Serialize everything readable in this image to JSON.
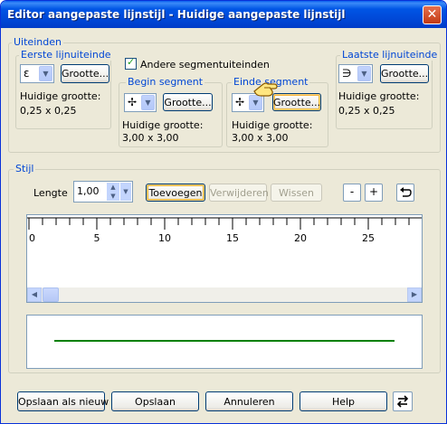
{
  "window": {
    "title": "Editor aangepaste lijnstijl - Huidige aangepaste lijnstijl",
    "close_glyph": "✕"
  },
  "ends": {
    "legend": "Uiteinden",
    "first": {
      "legend": "Eerste lijnuiteinde",
      "glyph": "ε",
      "size_button": "Grootte...",
      "current_label": "Huidige grootte:",
      "current_value": "0,25 x 0,25"
    },
    "last": {
      "legend": "Laatste lijnuiteinde",
      "glyph": "∋",
      "size_button": "Grootte...",
      "current_label": "Huidige grootte:",
      "current_value": "0,25 x 0,25"
    },
    "segment_checkbox": {
      "label": "Andere segmentuiteinden",
      "checked": true
    },
    "begin_segment": {
      "legend": "Begin segment",
      "glyph": "✢",
      "size_button": "Grootte...",
      "current_label": "Huidige grootte:",
      "current_value": "3,00 x 3,00"
    },
    "end_segment": {
      "legend": "Einde segment",
      "glyph": "✢",
      "size_button": "Grootte...",
      "current_label": "Huidige grootte:",
      "current_value": "3,00 x 3,00"
    }
  },
  "style": {
    "legend": "Stijl",
    "length_label": "Lengte",
    "length_value": "1,00",
    "add_button": "Toevoegen",
    "remove_button": "Verwijderen",
    "clear_button": "Wissen",
    "zoom_out": "-",
    "zoom_in": "+",
    "ruler_labels": [
      "0",
      "5",
      "10",
      "15",
      "20",
      "25"
    ],
    "preview_line_color": "#008000"
  },
  "footer": {
    "save_as_new": "Opslaan als nieuw",
    "save": "Opslaan",
    "cancel": "Annuleren",
    "help": "Help"
  }
}
